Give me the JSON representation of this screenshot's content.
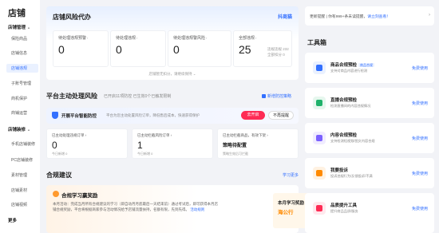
{
  "sidebar": {
    "title": "店铺",
    "groups": [
      {
        "label": "店铺管理",
        "items": [
          "保险商品",
          "店铺信息",
          "店铺违规",
          "子账号管理",
          "商机保护",
          "商铺运营"
        ]
      },
      {
        "label": "店铺装修",
        "items": [
          "手机店铺装修",
          "PC店铺装修",
          "素材管理",
          "店铺素材",
          "店铺视频"
        ]
      }
    ],
    "active_item": "店铺违规",
    "more": "更多"
  },
  "risk": {
    "title": "店铺风险代办",
    "brand": "抖商猫",
    "boxes": [
      {
        "label": "待处理违规预警",
        "value": "0"
      },
      {
        "label": "待处理违规",
        "value": "0"
      },
      {
        "label": "待处理违规警风险",
        "value": "0"
      },
      {
        "label": "全部违规",
        "value": "25",
        "sub1": "违规违规 232",
        "sub2": "全部扣分 0"
      }
    ],
    "footer": "店铺暂无扣分，请继续保持"
  },
  "proactive": {
    "title": "平台主动处理风险",
    "subtitle": "已开启11项防控 已生效0个已触发限制",
    "link": "新增防控策略",
    "banner_title": "开展平台智能防控",
    "banner_desc": "平台为您主动处置风险订单，降低售后成本，快速获得保护",
    "btn_on": "去开启",
    "btn_off": "不再提醒",
    "stats": [
      {
        "label": "已主动处理违规订单",
        "value": "0",
        "sub": "今日新增 0"
      },
      {
        "label": "已主动拦截风险订单",
        "value": "1",
        "sub": "今日新增 0"
      },
      {
        "label": "已主动拦截商品，有效下架",
        "value": "策略待配置",
        "sub": "策略生效后可拦截"
      }
    ]
  },
  "advice": {
    "title": "合规建议",
    "more": "学习更多",
    "card_title": "合规学习赢奖励",
    "card_desc": "本月活动：完成当月所有合规建议的学习（即自动月月底最后一天结束前）通过考试后，即可获得本月店铺合规奖励，平台将根据商家参与活动情况给予店铺流量扶持，名额有限，先到先得。",
    "card_link": "活动规则",
    "promo_1": "本月学习奖励",
    "promo_2": "海公行"
  },
  "notice": {
    "text_prefix": "更新提醒 | 你有999+条未读提醒，",
    "link": "请立刻查看！",
    "close": "›"
  },
  "tools": {
    "title": "工具箱",
    "items": [
      {
        "name": "商品合规预检",
        "tag": "商品合规",
        "desc": "支持对商品内容进行检测",
        "use": "免费使用",
        "icon": "shield-icon",
        "color": "#3370ff"
      },
      {
        "name": "直播合规预检",
        "tag": "",
        "desc": "检测直播间的内容违规情况",
        "use": "免费使用",
        "icon": "code-icon",
        "color": "#20b26b"
      },
      {
        "name": "内容合规预检",
        "tag": "",
        "desc": "支持检测短视频/图文内容合规",
        "use": "免费使用",
        "icon": "eye-icon",
        "color": "#7b61ff"
      },
      {
        "name": "我要投诉",
        "tag": "",
        "desc": "投诉违规行为/反馈投诉/不满",
        "use": "免费使用",
        "icon": "complaint-icon",
        "color": "#ff8a00"
      },
      {
        "name": "品质提升工具",
        "tag": "",
        "desc": "提升商品品质/服务",
        "use": "免费使用",
        "icon": "quality-icon",
        "color": "#fe2c55"
      }
    ]
  }
}
